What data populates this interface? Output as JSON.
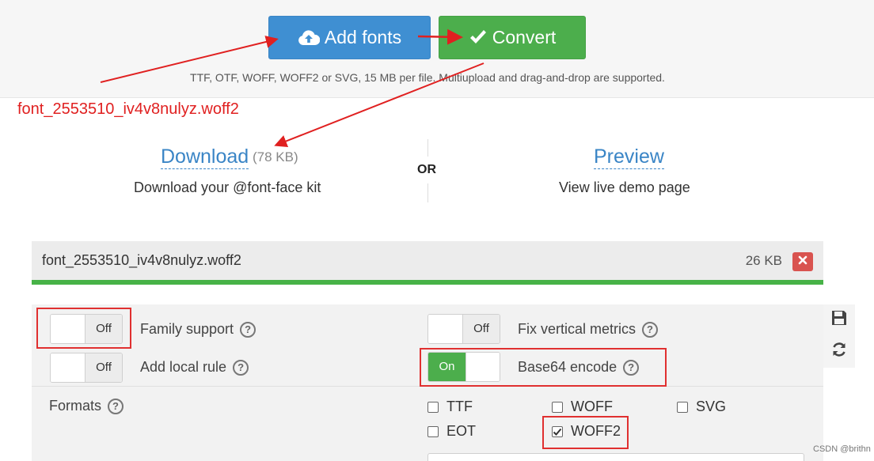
{
  "upload": {
    "add_fonts_label": "Add fonts",
    "convert_label": "Convert",
    "note": "TTF, OTF, WOFF, WOFF2 or SVG, 15 MB per file. Multiupload and drag-and-drop are supported."
  },
  "annotation": {
    "filename": "font_2553510_iv4v8nulyz.woff2"
  },
  "result": {
    "download_label": "Download",
    "download_size": "(78 KB)",
    "download_desc": "Download your @font-face kit",
    "or": "OR",
    "preview_label": "Preview",
    "preview_desc": "View live demo page"
  },
  "file": {
    "name": "font_2553510_iv4v8nulyz.woff2",
    "size": "26 KB"
  },
  "options": {
    "family_support": {
      "label": "Family support",
      "state": "Off"
    },
    "add_local_rule": {
      "label": "Add local rule",
      "state": "Off"
    },
    "fix_vertical_metrics": {
      "label": "Fix vertical metrics",
      "state": "Off"
    },
    "base64_encode": {
      "label": "Base64 encode",
      "state": "On"
    },
    "formats_label": "Formats",
    "formats": [
      {
        "label": "TTF",
        "checked": false
      },
      {
        "label": "WOFF",
        "checked": false
      },
      {
        "label": "SVG",
        "checked": false
      },
      {
        "label": "EOT",
        "checked": false
      },
      {
        "label": "WOFF2",
        "checked": true
      }
    ],
    "help_glyph": "?"
  },
  "icons": {
    "add_fonts": "cloud-upload-icon",
    "convert": "check-icon",
    "remove": "close-icon",
    "save": "save-icon",
    "refresh": "refresh-icon"
  },
  "colors": {
    "primary": "#3f8fd2",
    "success": "#4cae4c",
    "danger": "#d9534f",
    "annotation": "#e02020"
  },
  "watermark": "CSDN @brithn"
}
